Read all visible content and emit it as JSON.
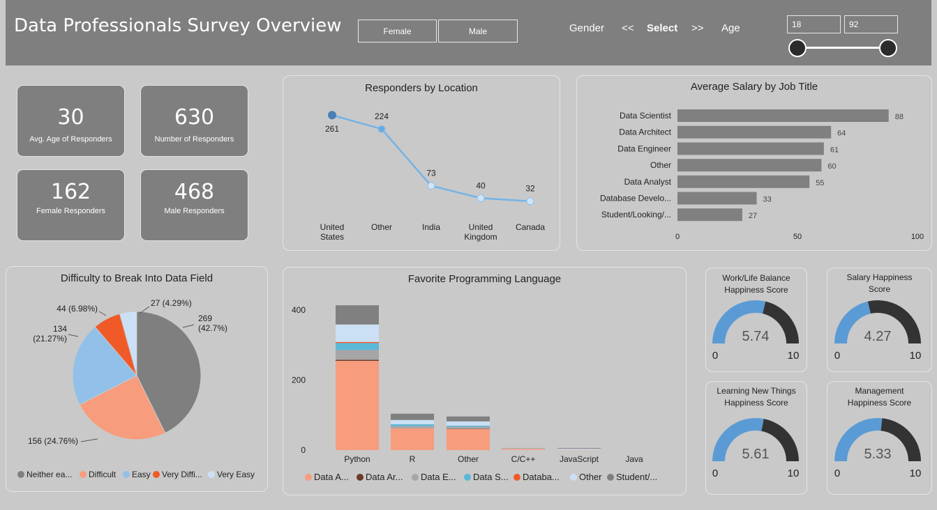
{
  "header": {
    "title": "Data Professionals Survey Overview",
    "female_btn": "Female",
    "male_btn": "Male",
    "gender_label": "Gender",
    "prev": "<<",
    "select": "Select",
    "next": ">>",
    "age_label": "Age",
    "age_min": "18",
    "age_max": "92"
  },
  "kpis": [
    {
      "value": "30",
      "label": "Avg. Age of Responders"
    },
    {
      "value": "630",
      "label": "Number of Responders"
    },
    {
      "value": "162",
      "label": "Female Responders"
    },
    {
      "value": "468",
      "label": "Male Responders"
    }
  ],
  "location_chart": {
    "title": "Responders by Location"
  },
  "salary_chart": {
    "title": "Average Salary by Job Title"
  },
  "pie_chart": {
    "title": "Difficulty to Break Into Data Field"
  },
  "lang_chart": {
    "title": "Favorite Programming Language"
  },
  "gauges": [
    {
      "title1": "Work/Life Balance",
      "title2": "Happiness Score",
      "value": "5.74",
      "score": 5.74,
      "min": "0",
      "max": "10"
    },
    {
      "title1": "Salary Happiness",
      "title2": "Score",
      "value": "4.27",
      "score": 4.27,
      "min": "0",
      "max": "10"
    },
    {
      "title1": "Learning New Things",
      "title2": "Happiness Score",
      "value": "5.61",
      "score": 5.61,
      "min": "0",
      "max": "10"
    },
    {
      "title1": "Management",
      "title2": "Happiness Score",
      "value": "5.33",
      "score": 5.33,
      "min": "0",
      "max": "10"
    }
  ],
  "colors": {
    "accent_blue": "#5b9bd5",
    "gauge_dark": "#333333",
    "bar_gray": "#808080"
  },
  "chart_data": [
    {
      "type": "line",
      "title": "Responders by Location",
      "categories": [
        "United States",
        "Other",
        "India",
        "United Kingdom",
        "Canada"
      ],
      "category_lines": [
        [
          "United",
          "States"
        ],
        [
          "Other"
        ],
        [
          "India"
        ],
        [
          "United",
          "Kingdom"
        ],
        [
          "Canada"
        ]
      ],
      "values": [
        261,
        224,
        73,
        40,
        32
      ],
      "ylim": [
        0,
        280
      ]
    },
    {
      "type": "bar",
      "orientation": "horizontal",
      "title": "Average Salary by Job Title",
      "categories": [
        "Data Scientist",
        "Data Architect",
        "Data Engineer",
        "Other",
        "Data Analyst",
        "Database Develo...",
        "Student/Looking/..."
      ],
      "values": [
        88,
        64,
        61,
        60,
        55,
        33,
        27
      ],
      "xlim": [
        0,
        100
      ],
      "xticks": [
        0,
        50,
        100
      ]
    },
    {
      "type": "pie",
      "title": "Difficulty to Break Into Data Field",
      "slices": [
        {
          "name": "Neither easy nor difficult",
          "legend": "Neither ea...",
          "value": 269,
          "label1": "269",
          "label2": "(42.7%)",
          "color": "#7f7f7f"
        },
        {
          "name": "Difficult",
          "legend": "Difficult",
          "value": 156,
          "label1": "156 (24.76%)",
          "label2": "",
          "color": "#f79c7c"
        },
        {
          "name": "Easy",
          "legend": "Easy",
          "value": 134,
          "label1": "134",
          "label2": "(21.27%)",
          "color": "#92c0e8"
        },
        {
          "name": "Very Difficult",
          "legend": "Very Diffi...",
          "value": 44,
          "label1": "44 (6.98%)",
          "label2": "",
          "color": "#f05a28"
        },
        {
          "name": "Very Easy",
          "legend": "Very Easy",
          "value": 27,
          "label1": "27 (4.29%)",
          "label2": "",
          "color": "#cce0f5"
        }
      ]
    },
    {
      "type": "bar",
      "stacked": true,
      "title": "Favorite Programming Language",
      "categories": [
        "Python",
        "R",
        "Other",
        "C/C++",
        "JavaScript",
        "Java"
      ],
      "ylim": [
        0,
        460
      ],
      "yticks": [
        0,
        200,
        400
      ],
      "series": [
        {
          "name": "Data Analyst",
          "legend": "Data A...",
          "color": "#f79c7c",
          "values": [
            255,
            62,
            60,
            3,
            1,
            0
          ]
        },
        {
          "name": "Data Architect",
          "legend": "Data Ar...",
          "color": "#6b3a2a",
          "values": [
            3,
            0,
            1,
            0,
            0,
            0
          ]
        },
        {
          "name": "Data Engineer",
          "legend": "Data E...",
          "color": "#a6a6a6",
          "values": [
            28,
            7,
            6,
            0,
            0,
            0
          ]
        },
        {
          "name": "Data Scientist",
          "legend": "Data S...",
          "color": "#5bb8d8",
          "values": [
            20,
            5,
            3,
            0,
            0,
            0
          ]
        },
        {
          "name": "Database Developer",
          "legend": "Databa...",
          "color": "#f05a28",
          "values": [
            3,
            0,
            0,
            0,
            0,
            0
          ]
        },
        {
          "name": "Other",
          "legend": "Other",
          "color": "#cce0f5",
          "values": [
            50,
            12,
            12,
            1,
            3,
            0
          ]
        },
        {
          "name": "Student/Looking/None",
          "legend": "Student/...",
          "color": "#808080",
          "values": [
            55,
            18,
            14,
            1,
            2,
            0
          ]
        }
      ]
    }
  ]
}
